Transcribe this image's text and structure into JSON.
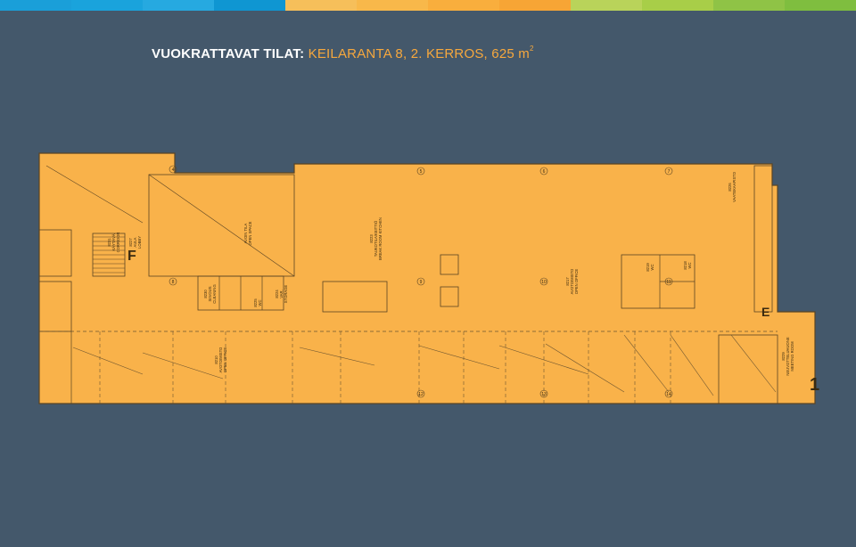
{
  "topbar": {
    "colors": [
      "#1a9fd9",
      "#1aa3dc",
      "#26a9e0",
      "#0f96d2",
      "#f6bf5a",
      "#f8b84a",
      "#f9ae3d",
      "#f7a535",
      "#b9d35a",
      "#a8ce48",
      "#8fc346",
      "#7fbe3f"
    ]
  },
  "title": {
    "prefix": "VUOKRATTAVAT TILAT:",
    "location": " KEILARANTA 8, 2. KERROS, 625 m",
    "superscript": "2"
  },
  "plan": {
    "colors": {
      "floor": "#f9b24a",
      "floor_light": "#fbc065",
      "line": "#5a4424",
      "dash": "#6d5530"
    },
    "marker_F": "F",
    "marker_E": "E",
    "marker_1": "1",
    "rooms": [
      {
        "id": "r8226",
        "code": "8226",
        "name": "VAATEKAAPISTO"
      },
      {
        "id": "r8223",
        "code": "8223",
        "name": "TAUKOTILA/KEITTIÖ",
        "name2": "BREAK ROOM KITCHEN"
      },
      {
        "id": "r8217",
        "code": "8217",
        "name": "AVOTOIMISTO",
        "name2": "OPEN OFFICE"
      },
      {
        "id": "r8219",
        "code": "8219",
        "name": "WC"
      },
      {
        "id": "r8218",
        "code": "8218",
        "name": "WC"
      },
      {
        "id": "r8224",
        "code": "8224",
        "name": "VAR.",
        "name2": "STORAGE"
      },
      {
        "id": "r8225",
        "code": "8225",
        "name": "WC"
      },
      {
        "id": "r8230",
        "code": "8230",
        "name": "SIIVOUS",
        "name2": "CLEANING"
      },
      {
        "id": "r8210",
        "code": "8210",
        "name": "AVOTOIMISTO",
        "name2": "OPEN OFFICE"
      },
      {
        "id": "r8229",
        "code": "8229",
        "name": "NEUVOTTELUHUONE",
        "name2": "MEETING ROOM"
      },
      {
        "id": "r8231",
        "code": "8231",
        "name": "KÄYTÄVÄ",
        "name2": "CORRIDOR"
      },
      {
        "id": "rlobby",
        "code": "8227",
        "name": "AULA",
        "name2": "LOBBY"
      },
      {
        "id": "rvoid",
        "code": "",
        "name": "AVOIN TILA",
        "name2": "OPEN SPACE"
      }
    ],
    "column_tags": [
      "4",
      "5",
      "6",
      "7",
      "8",
      "9",
      "10",
      "11",
      "12",
      "13",
      "14"
    ]
  }
}
